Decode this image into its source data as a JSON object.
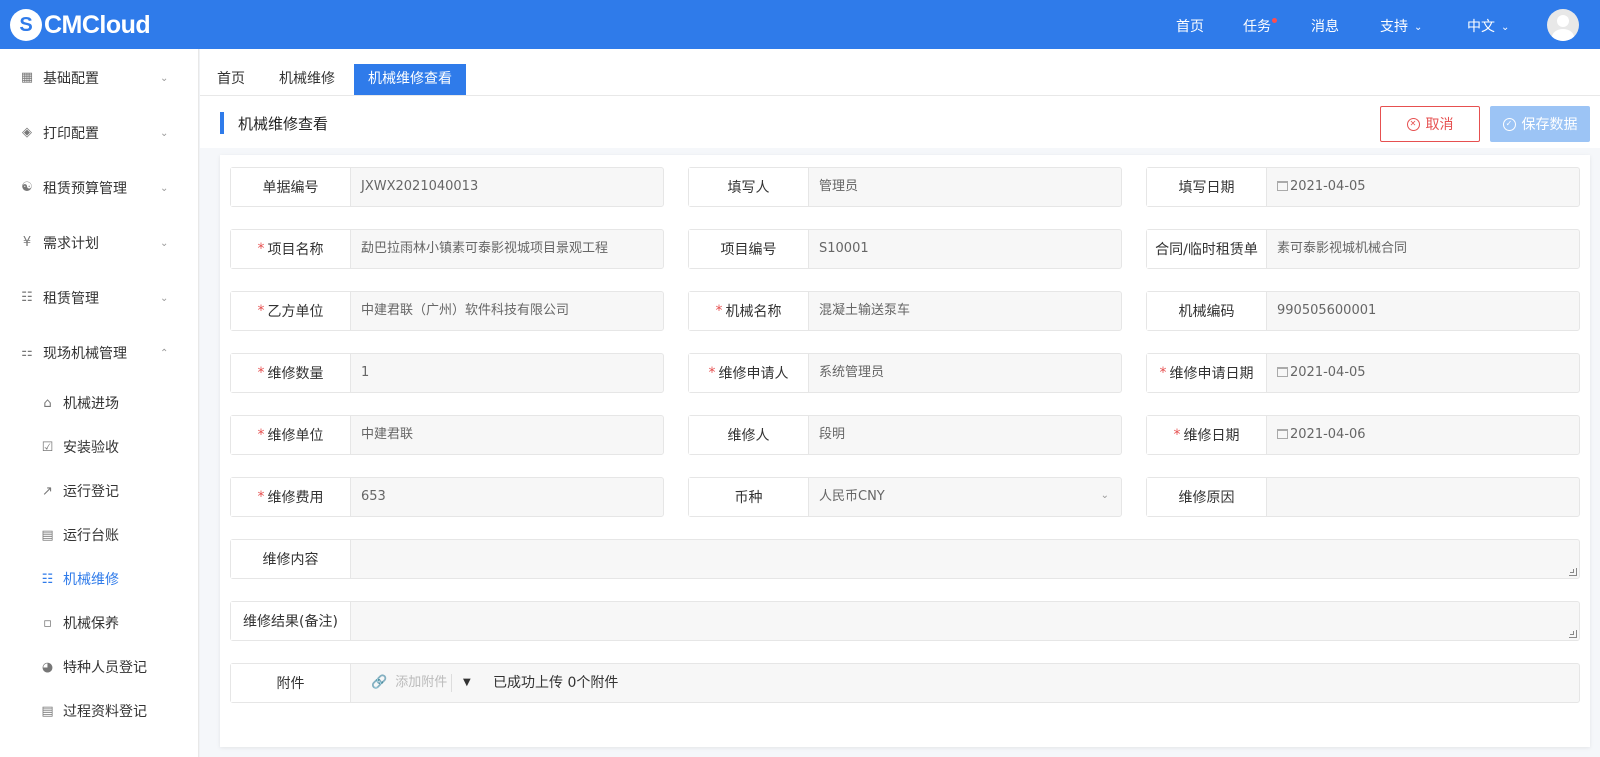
{
  "app": {
    "logo_text": "CMCloud",
    "logo_mark": "S"
  },
  "topnav": {
    "home": "首页",
    "tasks": "任务",
    "messages": "消息",
    "support": "支持",
    "language": "中文"
  },
  "sidebar": {
    "groups": [
      {
        "label": "基础配置",
        "icon": "grid-icon"
      },
      {
        "label": "打印配置",
        "icon": "layers-icon"
      },
      {
        "label": "租赁预算管理",
        "icon": "database-icon"
      },
      {
        "label": "需求计划",
        "icon": "plan-icon"
      },
      {
        "label": "租赁管理",
        "icon": "org-icon"
      },
      {
        "label": "现场机械管理",
        "icon": "machine-icon"
      }
    ],
    "items": [
      {
        "label": "机械进场",
        "icon": "home-icon"
      },
      {
        "label": "安装验收",
        "icon": "check-icon"
      },
      {
        "label": "运行登记",
        "icon": "chart-icon"
      },
      {
        "label": "运行台账",
        "icon": "ledger-icon"
      },
      {
        "label": "机械维修",
        "icon": "org-icon"
      },
      {
        "label": "机械保养",
        "icon": "clipboard-icon"
      },
      {
        "label": "特种人员登记",
        "icon": "helmet-icon"
      },
      {
        "label": "过程资料登记",
        "icon": "archive-icon"
      }
    ]
  },
  "tabs": [
    "首页",
    "机械维修",
    "机械维修查看"
  ],
  "page": {
    "title": "机械维修查看",
    "cancel_label": "取消",
    "save_label": "保存数据"
  },
  "form": {
    "doc_no": {
      "label": "单据编号",
      "value": "JXWX2021040013"
    },
    "writer": {
      "label": "填写人",
      "value": "管理员"
    },
    "write_date": {
      "label": "填写日期",
      "value": "2021-04-05"
    },
    "project_name": {
      "label": "项目名称",
      "value": "勐巴拉雨林小镇素可泰影视城项目景观工程"
    },
    "project_no": {
      "label": "项目编号",
      "value": "S10001"
    },
    "contract": {
      "label": "合同/临时租赁单",
      "value": "素可泰影视城机械合同"
    },
    "party_b": {
      "label": "乙方单位",
      "value": "中建君联（广州）软件科技有限公司"
    },
    "machine_name": {
      "label": "机械名称",
      "value": "混凝土输送泵车"
    },
    "machine_code": {
      "label": "机械编码",
      "value": "990505600001"
    },
    "repair_qty": {
      "label": "维修数量",
      "value": "1"
    },
    "applicant": {
      "label": "维修申请人",
      "value": "系统管理员"
    },
    "apply_date": {
      "label": "维修申请日期",
      "value": "2021-04-05"
    },
    "repair_unit": {
      "label": "维修单位",
      "value": "中建君联"
    },
    "repairer": {
      "label": "维修人",
      "value": "段明"
    },
    "repair_date": {
      "label": "维修日期",
      "value": "2021-04-06"
    },
    "repair_cost": {
      "label": "维修费用",
      "value": "653"
    },
    "currency": {
      "label": "币种",
      "value": "人民币CNY"
    },
    "repair_reason": {
      "label": "维修原因",
      "value": ""
    },
    "repair_content": {
      "label": "维修内容",
      "value": ""
    },
    "repair_result": {
      "label": "维修结果(备注)",
      "value": ""
    },
    "attachment": {
      "label": "附件",
      "add_label": "添加附件",
      "status": "已成功上传 0个附件"
    }
  },
  "colors": {
    "primary": "#2f7bea",
    "danger": "#e65050",
    "save_disabled": "#9cc4f5"
  }
}
